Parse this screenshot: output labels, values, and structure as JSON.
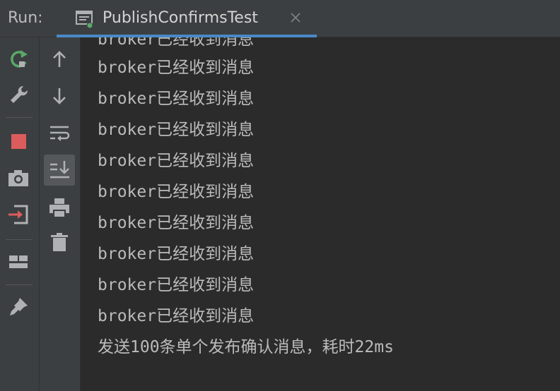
{
  "header": {
    "run_label": "Run:",
    "tab_title": "PublishConfirmsTest"
  },
  "toolbar": {
    "left": [
      {
        "name": "rerun-icon",
        "color": "#59a869"
      },
      {
        "name": "wrench-icon",
        "color": "#afb1b3"
      },
      {
        "name": "stop-icon",
        "color": "#db5c5c"
      },
      {
        "name": "camera-icon",
        "color": "#afb1b3"
      },
      {
        "name": "exit-icon",
        "color": "#db5c5c"
      },
      {
        "name": "layout-icon",
        "color": "#afb1b3"
      },
      {
        "name": "pin-icon",
        "color": "#afb1b3"
      }
    ],
    "right": [
      {
        "name": "arrow-up-icon"
      },
      {
        "name": "arrow-down-icon"
      },
      {
        "name": "soft-wrap-icon"
      },
      {
        "name": "scroll-to-end-icon",
        "pressed": true
      },
      {
        "name": "print-icon"
      },
      {
        "name": "trash-icon"
      }
    ]
  },
  "console": {
    "lines": [
      "broker已经收到消息",
      "broker已经收到消息",
      "broker已经收到消息",
      "broker已经收到消息",
      "broker已经收到消息",
      "broker已经收到消息",
      "broker已经收到消息",
      "broker已经收到消息",
      "broker已经收到消息",
      "broker已经收到消息",
      "发送100条单个发布确认消息，耗时22ms"
    ]
  }
}
